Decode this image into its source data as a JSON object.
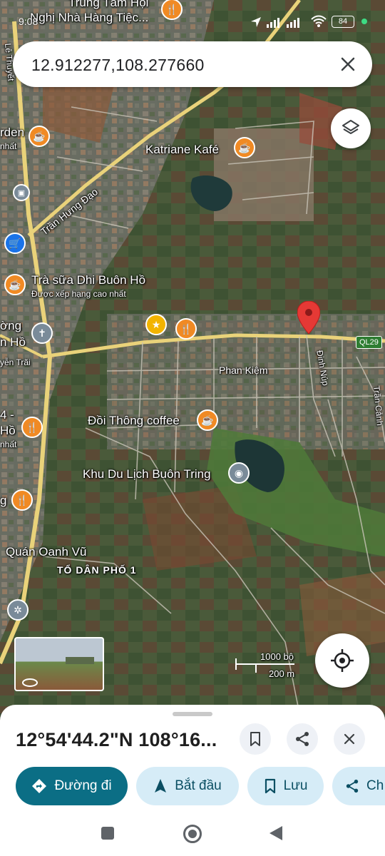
{
  "status_bar": {
    "time": "9:08",
    "battery": "84"
  },
  "search": {
    "query": "12.912277,108.277660"
  },
  "map_labels": {
    "top_poi_1": "Trung Tâm Hội",
    "top_poi_2": "Nghị Nhà Hàng Tiệc...",
    "road_left_vertical": "Lê Thuyết",
    "garden_partial": "rden",
    "garden_partial_sub": "nhất",
    "katriane": "Katriane Kafé",
    "tran_hung_dao": "Trần Hưng Đạo",
    "tra_sua": "Trà sữa Dhi Buôn Hồ",
    "tra_sua_sub": "Được xếp hạng cao nhất",
    "left_truong": "ờng",
    "left_ho": "n Hồ",
    "nguyen_trai": "yễn Trãi",
    "ql29": "QL29",
    "dinh_nup": "Đinh Núp",
    "phan_kiem": "Phan Kiệm",
    "tran_canh": "Trần Cảnh",
    "doi_thong": "Đồi Thông coffee",
    "left_4": "4 -",
    "left_ho2": "Hồ",
    "left_nhat": "nhất",
    "khu_du_lich": "Khu Du Lịch Buôn Tring",
    "left_g": "g",
    "quan_oanh_vu": "Quán Oanh Vũ",
    "to_dan_pho": "TỔ DÂN PHỐ 1",
    "scale_feet": "1000 bộ",
    "scale_m": "200 m"
  },
  "sheet": {
    "coordinates": "12°54'44.2\"N 108°16...",
    "actions": {
      "directions": "Đường đi",
      "start": "Bắt đầu",
      "save": "Lưu",
      "share_partial": "Ch"
    }
  },
  "colors": {
    "primary": "#0b6e85",
    "secondary_chip": "#d6ecf7",
    "pin_red": "#e53935",
    "poi_orange": "#f08a24"
  }
}
